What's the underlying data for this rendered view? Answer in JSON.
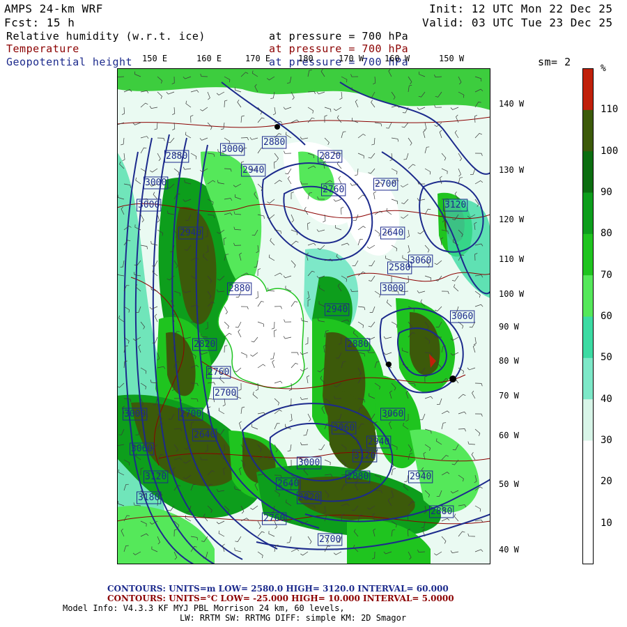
{
  "header": {
    "model": "AMPS 24-km WRF",
    "forecast": "Fcst:   15 h",
    "init": "Init: 12 UTC Mon 22 Dec 25",
    "valid": "Valid: 03 UTC Tue 23 Dec 25"
  },
  "fields": [
    {
      "name": "Relative humidity (w.r.t. ice)",
      "level": "at pressure =  700 hPa",
      "color": "#000000"
    },
    {
      "name": "Temperature",
      "level": "at pressure =  700 hPa",
      "color": "#8b0000"
    },
    {
      "name": "Geopotential height",
      "level": "at pressure =  700 hPa",
      "color": "#1c2a8c"
    }
  ],
  "smoothing": "sm= 2",
  "top_ticks": [
    "150 E",
    "160 E",
    "170 E",
    "180",
    "170 W",
    "160 W",
    "150 W"
  ],
  "right_ticks": [
    "140 W",
    "130 W",
    "120 W",
    "110 W",
    "100 W",
    "90 W",
    "80 W",
    "70 W",
    "60 W",
    "50 W",
    "40 W"
  ],
  "colorbar": {
    "unit": "%",
    "labels": [
      "10",
      "20",
      "30",
      "40",
      "50",
      "60",
      "70",
      "80",
      "90",
      "100",
      "110"
    ],
    "colors": [
      "#ffffff",
      "#ffffff",
      "#ffffff",
      "#d8f5e8",
      "#7de8c8",
      "#3cdba3",
      "#55e85a",
      "#1fc41f",
      "#0d9e1c",
      "#0b6e10",
      "#3c5a0a",
      "#c0200a"
    ]
  },
  "height_labels": [
    "3000",
    "3000",
    "2880",
    "2940",
    "3000",
    "2940",
    "2880",
    "2820",
    "2760",
    "2700",
    "2700",
    "2640",
    "2880",
    "2820",
    "2760",
    "2700",
    "2640",
    "2580",
    "2940",
    "2880",
    "3000",
    "3060",
    "3120",
    "3060",
    "3000",
    "3060",
    "3120",
    "3060",
    "2940",
    "2880",
    "3000",
    "3060",
    "3120",
    "3180",
    "2940",
    "2880",
    "2820",
    "2760",
    "2700",
    "2640"
  ],
  "footer": {
    "height_contours": "CONTOURS:  UNITS=m  LOW=  2580.0      HIGH=  3120.0      INTERVAL=   60.000",
    "temp_contours": "CONTOURS:  UNITS=°C  LOW= -25.000      HIGH=  10.000      INTERVAL=   5.0000",
    "model_info_1": "Model Info: V4.3.3   KF      MYJ PBL  Morrison          24 km,    60 levels,",
    "model_info_2": "LW: RRTM SW: RRTMG   DIFF: simple KM: 2D Smagor"
  }
}
